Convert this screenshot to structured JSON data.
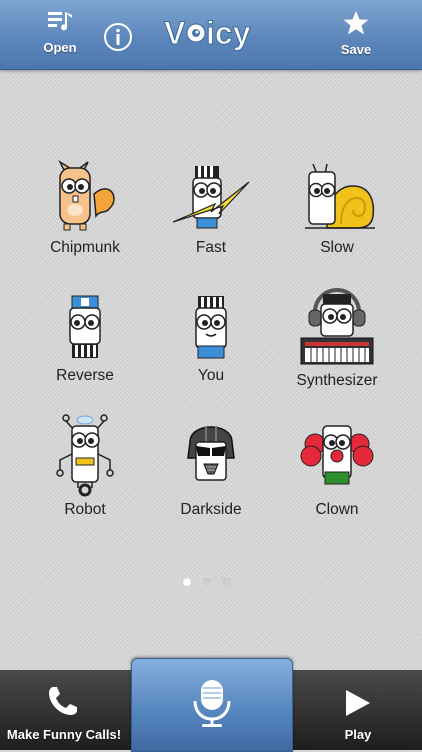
{
  "header": {
    "open_label": "Open",
    "save_label": "Save",
    "logo_text": "Voicy"
  },
  "effects": [
    {
      "label": "Chipmunk"
    },
    {
      "label": "Fast"
    },
    {
      "label": "Slow"
    },
    {
      "label": "Reverse"
    },
    {
      "label": "You"
    },
    {
      "label": "Synthesizer"
    },
    {
      "label": "Robot"
    },
    {
      "label": "Darkside"
    },
    {
      "label": "Clown"
    }
  ],
  "pager": {
    "pages": 3,
    "current": 1
  },
  "footer": {
    "calls_label": "Make Funny Calls!",
    "play_label": "Play"
  },
  "colors": {
    "header_blue": "#5d86bb",
    "record_blue": "#5b8ac2",
    "footer_dark": "#2a2a2a"
  }
}
